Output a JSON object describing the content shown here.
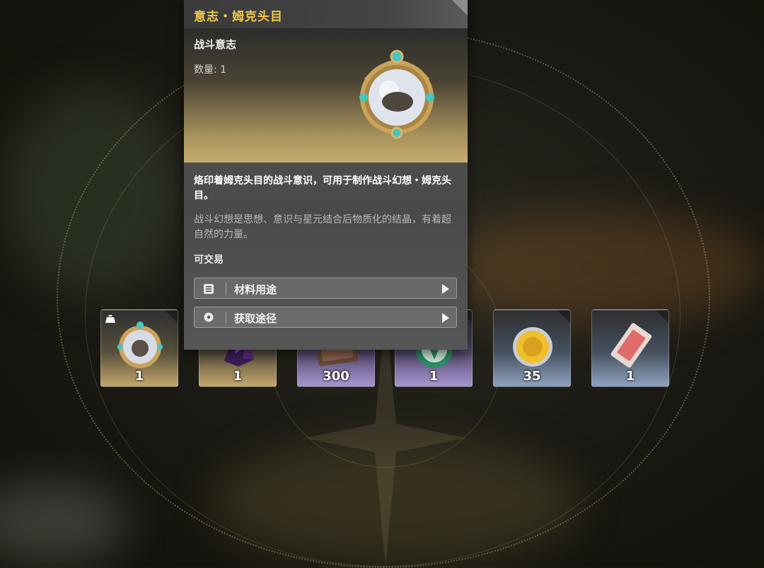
{
  "tooltip": {
    "title": "意志・姆克头目",
    "item_type": "战斗意志",
    "quantity_label": "数量: 1",
    "description": "烙印着姆克头目的战斗意识，可用于制作战斗幻想・姆克头目。",
    "lore": "战斗幻想是思想、意识与星元结合后物质化的结晶，有着超自然的力量。",
    "tradable": "可交易",
    "buttons": [
      {
        "label": "材料用途",
        "icon": "list-icon"
      },
      {
        "label": "获取途径",
        "icon": "location-pin-icon"
      }
    ]
  },
  "rewards": [
    {
      "count": "1",
      "rarity": "gold",
      "icon": "battle-will-medal-icon"
    },
    {
      "count": "1",
      "rarity": "gold",
      "icon": "dark-crystal-icon"
    },
    {
      "count": "300",
      "rarity": "purple",
      "icon": "book-icon"
    },
    {
      "count": "1",
      "rarity": "purple",
      "icon": "green-emblem-icon"
    },
    {
      "count": "35",
      "rarity": "blue",
      "icon": "gold-coin-icon"
    },
    {
      "count": "1",
      "rarity": "blue",
      "icon": "ticket-icon"
    }
  ],
  "colors": {
    "title": "#f2c94c",
    "gold_rarity": "#c4a66c",
    "purple_rarity": "#a895d0",
    "blue_rarity": "#8ea2c0"
  }
}
